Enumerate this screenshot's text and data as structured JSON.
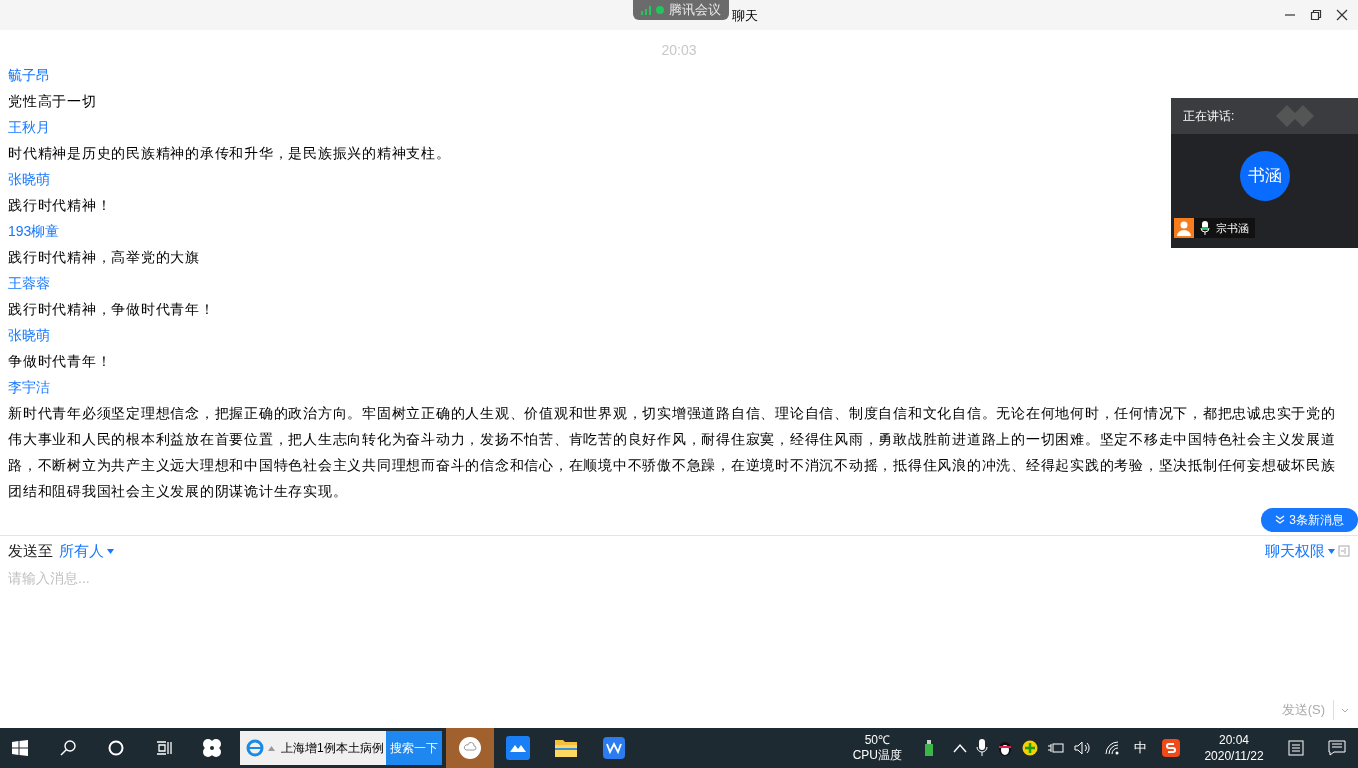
{
  "window": {
    "title": "聊天"
  },
  "meeting_pill": {
    "label": "腾讯会议"
  },
  "chat": {
    "time": "20:03",
    "messages": [
      {
        "sender": "毓子昂",
        "text": "党性高于一切"
      },
      {
        "sender": "王秋月",
        "text": "时代精神是历史的民族精神的承传和升华，是民族振兴的精神支柱。"
      },
      {
        "sender": "张晓萌",
        "text": "践行时代精神！"
      },
      {
        "sender": "193柳童",
        "text": "践行时代精神，高举党的大旗"
      },
      {
        "sender": "王蓉蓉",
        "text": "践行时代精神，争做时代青年！"
      },
      {
        "sender": "张晓萌",
        "text": "争做时代青年！"
      },
      {
        "sender": "李宇洁",
        "text": "新时代青年必须坚定理想信念，把握正确的政治方向。牢固树立正确的人生观、价值观和世界观，切实增强道路自信、理论自信、制度自信和文化自信。无论在何地何时，任何情况下，都把忠诚忠实于党的伟大事业和人民的根本利益放在首要位置，把人生志向转化为奋斗动力，发扬不怕苦、肯吃苦的良好作风，耐得住寂寞，经得住风雨，勇敢战胜前进道路上的一切困难。坚定不移走中国特色社会主义发展道路，不断树立为共产主义远大理想和中国特色社会主义共同理想而奋斗的信念和信心，在顺境中不骄傲不急躁，在逆境时不消沉不动摇，抵得住风浪的冲洗、经得起实践的考验，坚决抵制任何妄想破坏民族团结和阻碍我国社会主义发展的阴谋诡计生存实现。"
      }
    ],
    "new_messages": "3条新消息"
  },
  "speaker_panel": {
    "label": "正在讲话:",
    "avatar": "书涵",
    "name": "宗书涵"
  },
  "composer": {
    "send_to_label": "发送至",
    "recipient": "所有人",
    "permissions": "聊天权限",
    "placeholder": "请输入消息...",
    "send_button": "发送(S)"
  },
  "taskbar": {
    "search_box": "上海增1例本土病例",
    "search_button": "搜索一下",
    "cpu_temp": "50℃",
    "cpu_label": "CPU温度",
    "ime": "中",
    "time": "20:04",
    "date": "2020/11/22"
  }
}
